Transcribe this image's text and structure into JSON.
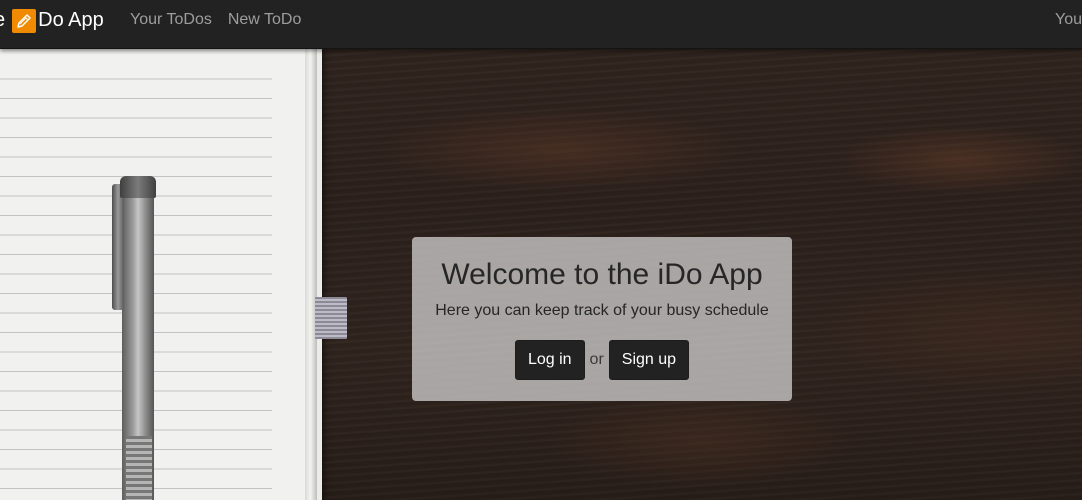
{
  "navbar": {
    "brand_prefix": "e",
    "brand_suffix": "Do App",
    "brand_icon": "pencil-icon",
    "links": [
      "Your ToDos",
      "New ToDo"
    ],
    "right_text": "You"
  },
  "welcome": {
    "title": "Welcome to the iDo App",
    "subtitle": "Here you can keep track of your busy schedule",
    "login_label": "Log in",
    "or_text": "or",
    "signup_label": "Sign up"
  },
  "colors": {
    "navbar_bg": "#222222",
    "brand_icon_bg": "#f08a00",
    "button_bg": "#222222"
  }
}
